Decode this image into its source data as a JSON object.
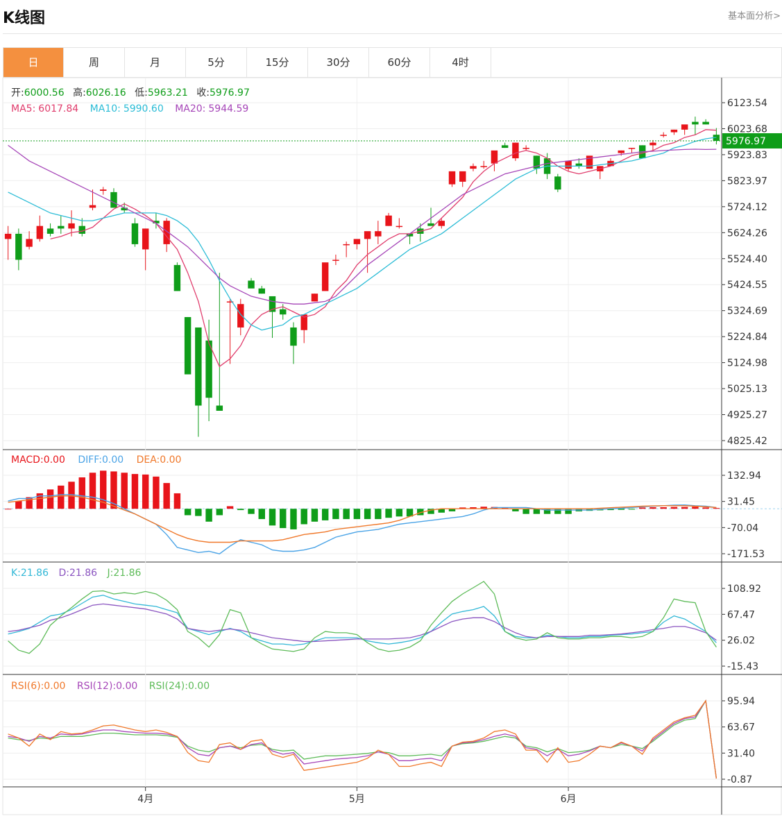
{
  "header": {
    "title": "K线图",
    "more_link": "基本面分析>"
  },
  "tabs": [
    {
      "label": "日",
      "active": true
    },
    {
      "label": "周"
    },
    {
      "label": "月"
    },
    {
      "label": "5分"
    },
    {
      "label": "15分"
    },
    {
      "label": "30分"
    },
    {
      "label": "60分"
    },
    {
      "label": "4时"
    }
  ],
  "colors": {
    "up": "#e8141a",
    "down": "#0f9d19",
    "ma5": "#e03c6c",
    "ma10": "#2bbcd6",
    "ma20": "#a646b8",
    "macd_line": "#f0782a",
    "diff_line": "#4aa3e6",
    "k": "#31b7d6",
    "d": "#8a54c0",
    "j": "#5dbb58",
    "rsi6": "#f0782a",
    "rsi12": "#a646b8",
    "rsi24": "#5dbb58",
    "price_line": "#0f9d19"
  },
  "chart_data": [
    {
      "type": "candlestick",
      "title": "K线图",
      "ohlc_legend": {
        "open_label": "开:",
        "open": "6000.56",
        "high_label": "高:",
        "high": "6026.16",
        "low_label": "低:",
        "low": "5963.21",
        "close_label": "收:",
        "close": "5976.97"
      },
      "ma_legend": {
        "ma5_label": "MA5:",
        "ma5": "6017.84",
        "ma10_label": "MA10:",
        "ma10": "5990.60",
        "ma20_label": "MA20:",
        "ma20": "5944.59"
      },
      "current_price": "5976.97",
      "yticks": [
        "6123.54",
        "6023.68",
        "5923.83",
        "5823.97",
        "5724.12",
        "5624.26",
        "5524.40",
        "5424.55",
        "5324.69",
        "5224.84",
        "5124.98",
        "5025.13",
        "4925.27",
        "4825.42"
      ],
      "ylim": [
        4825.42,
        6123.54
      ],
      "xticks": [
        {
          "label": "4月",
          "index": 13
        },
        {
          "label": "5月",
          "index": 33
        },
        {
          "label": "6月",
          "index": 53
        }
      ],
      "candles": [
        [
          5600,
          5650,
          5520,
          5620
        ],
        [
          5620,
          5640,
          5480,
          5520
        ],
        [
          5570,
          5630,
          5560,
          5600
        ],
        [
          5600,
          5690,
          5590,
          5650
        ],
        [
          5640,
          5660,
          5610,
          5620
        ],
        [
          5650,
          5690,
          5620,
          5640
        ],
        [
          5640,
          5710,
          5610,
          5660
        ],
        [
          5650,
          5680,
          5610,
          5620
        ],
        [
          5720,
          5790,
          5710,
          5730
        ],
        [
          5785,
          5800,
          5770,
          5790
        ],
        [
          5780,
          5795,
          5720,
          5720
        ],
        [
          5720,
          5740,
          5700,
          5710
        ],
        [
          5660,
          5680,
          5570,
          5580
        ],
        [
          5560,
          5640,
          5480,
          5640
        ],
        [
          5670,
          5700,
          5640,
          5660
        ],
        [
          5580,
          5680,
          5550,
          5670
        ],
        [
          5500,
          5510,
          5400,
          5400
        ],
        [
          5300,
          5300,
          5080,
          5080
        ],
        [
          5260,
          5260,
          4840,
          4960
        ],
        [
          5210,
          5290,
          4900,
          4990
        ],
        [
          4960,
          5470,
          4950,
          4940
        ],
        [
          5360,
          5370,
          5120,
          5360
        ],
        [
          5260,
          5370,
          5230,
          5350
        ],
        [
          5440,
          5450,
          5420,
          5410
        ],
        [
          5410,
          5420,
          5390,
          5390
        ],
        [
          5380,
          5380,
          5220,
          5320
        ],
        [
          5330,
          5350,
          5290,
          5310
        ],
        [
          5260,
          5280,
          5120,
          5190
        ],
        [
          5250,
          5290,
          5200,
          5310
        ],
        [
          5360,
          5390,
          5360,
          5390
        ],
        [
          5400,
          5500,
          5400,
          5510
        ],
        [
          5520,
          5540,
          5500,
          5520
        ],
        [
          5580,
          5590,
          5530,
          5580
        ],
        [
          5580,
          5590,
          5560,
          5600
        ],
        [
          5600,
          5610,
          5470,
          5630
        ],
        [
          5610,
          5670,
          5580,
          5630
        ],
        [
          5650,
          5700,
          5650,
          5690
        ],
        [
          5650,
          5680,
          5640,
          5650
        ],
        [
          5620,
          5620,
          5580,
          5610
        ],
        [
          5640,
          5660,
          5590,
          5620
        ],
        [
          5660,
          5720,
          5660,
          5650
        ],
        [
          5650,
          5680,
          5640,
          5670
        ],
        [
          5810,
          5820,
          5800,
          5860
        ],
        [
          5820,
          5850,
          5800,
          5860
        ],
        [
          5870,
          5890,
          5860,
          5880
        ],
        [
          5880,
          5900,
          5870,
          5880
        ],
        [
          5890,
          5920,
          5860,
          5940
        ],
        [
          5960,
          5970,
          5950,
          5950
        ],
        [
          5910,
          5970,
          5900,
          5970
        ],
        [
          5950,
          5960,
          5940,
          5950
        ],
        [
          5920,
          5920,
          5850,
          5870
        ],
        [
          5910,
          5930,
          5830,
          5850
        ],
        [
          5840,
          5850,
          5780,
          5790
        ],
        [
          5870,
          5890,
          5860,
          5900
        ],
        [
          5890,
          5910,
          5870,
          5880
        ],
        [
          5870,
          5910,
          5870,
          5920
        ],
        [
          5860,
          5880,
          5830,
          5880
        ],
        [
          5880,
          5910,
          5880,
          5900
        ],
        [
          5930,
          5940,
          5920,
          5940
        ],
        [
          5950,
          5950,
          5930,
          5950
        ],
        [
          5960,
          5960,
          5930,
          5910
        ],
        [
          5960,
          5980,
          5940,
          5970
        ],
        [
          6000,
          6010,
          5990,
          6000
        ],
        [
          6010,
          6020,
          6000,
          6020
        ],
        [
          6020,
          6030,
          6000,
          6040
        ],
        [
          6050,
          6070,
          6000,
          6040
        ],
        [
          6050,
          6060,
          6040,
          6040
        ],
        [
          6000.56,
          6026.16,
          5963.21,
          5976.97
        ]
      ],
      "ma5": [
        null,
        null,
        null,
        null,
        5600,
        5610,
        5625,
        5630,
        5645,
        5680,
        5715,
        5735,
        5715,
        5690,
        5660,
        5610,
        5560,
        5470,
        5360,
        5200,
        5110,
        5140,
        5190,
        5270,
        5310,
        5330,
        5340,
        5320,
        5300,
        5310,
        5340,
        5400,
        5440,
        5500,
        5540,
        5570,
        5600,
        5620,
        5620,
        5630,
        5640,
        5680,
        5720,
        5760,
        5820,
        5860,
        5890,
        5910,
        5930,
        5940,
        5930,
        5910,
        5880,
        5860,
        5850,
        5860,
        5870,
        5880,
        5900,
        5920,
        5930,
        5940,
        5960,
        5970,
        5990,
        6000,
        6020,
        6017.84
      ],
      "ma10": [
        5780,
        5760,
        5740,
        5720,
        5700,
        5690,
        5680,
        5670,
        5670,
        5680,
        5690,
        5700,
        5700,
        5700,
        5700,
        5690,
        5670,
        5640,
        5590,
        5520,
        5440,
        5370,
        5310,
        5270,
        5250,
        5260,
        5270,
        5300,
        5310,
        5330,
        5350,
        5370,
        5390,
        5410,
        5440,
        5470,
        5500,
        5530,
        5560,
        5580,
        5600,
        5620,
        5650,
        5680,
        5710,
        5740,
        5770,
        5800,
        5830,
        5850,
        5870,
        5880,
        5880,
        5880,
        5880,
        5880,
        5885,
        5890,
        5895,
        5900,
        5910,
        5920,
        5930,
        5950,
        5960,
        5975,
        5985,
        5990.6
      ],
      "ma20": [
        5960,
        5930,
        5900,
        5880,
        5860,
        5840,
        5820,
        5800,
        5780,
        5760,
        5740,
        5720,
        5700,
        5680,
        5660,
        5630,
        5600,
        5570,
        5530,
        5490,
        5450,
        5420,
        5400,
        5380,
        5370,
        5360,
        5355,
        5350,
        5350,
        5355,
        5360,
        5380,
        5420,
        5460,
        5500,
        5530,
        5560,
        5590,
        5620,
        5650,
        5680,
        5710,
        5740,
        5770,
        5790,
        5810,
        5830,
        5850,
        5860,
        5870,
        5880,
        5890,
        5895,
        5900,
        5905,
        5910,
        5915,
        5920,
        5925,
        5930,
        5935,
        5937,
        5940,
        5942,
        5944,
        5945,
        5944,
        5944.59
      ]
    },
    {
      "type": "bar",
      "title": "MACD",
      "legend": {
        "macd_label": "MACD:",
        "macd": "0.00",
        "diff_label": "DIFF:",
        "diff": "0.00",
        "dea_label": "DEA:",
        "dea": "0.00"
      },
      "yticks": [
        "132.94",
        "31.45",
        "-70.04",
        "-171.53"
      ],
      "ylim": [
        -171.53,
        132.94
      ],
      "zero": 3,
      "histogram": [
        0,
        30,
        45,
        60,
        75,
        90,
        105,
        122,
        140,
        148,
        145,
        140,
        135,
        133,
        125,
        100,
        60,
        -25,
        -28,
        -50,
        -25,
        10,
        -5,
        -20,
        -40,
        -65,
        -75,
        -80,
        -60,
        -50,
        -45,
        -40,
        -40,
        -40,
        -40,
        -40,
        -35,
        -30,
        -30,
        -25,
        -20,
        -15,
        -10,
        5,
        6,
        8,
        7,
        4,
        -10,
        -20,
        -20,
        -20,
        -20,
        -20,
        -10,
        -8,
        -6,
        -5,
        -4,
        -3,
        5,
        6,
        6,
        7,
        7,
        8,
        5,
        3
      ],
      "diff": [
        30,
        40,
        40,
        50,
        50,
        55,
        55,
        50,
        45,
        35,
        20,
        0,
        -20,
        -40,
        -60,
        -100,
        -150,
        -160,
        -170,
        -165,
        -175,
        -145,
        -120,
        -130,
        -140,
        -160,
        -165,
        -165,
        -160,
        -150,
        -130,
        -110,
        -100,
        -90,
        -85,
        -80,
        -70,
        -60,
        -55,
        -50,
        -45,
        -40,
        -35,
        -30,
        -20,
        -5,
        5,
        5,
        5,
        5,
        0,
        -5,
        -5,
        -5,
        -5,
        -5,
        -2,
        0,
        2,
        5,
        8,
        10,
        12,
        14,
        15,
        12,
        10,
        5
      ],
      "dea": [
        25,
        30,
        35,
        40,
        45,
        50,
        50,
        45,
        35,
        25,
        10,
        -5,
        -20,
        -40,
        -60,
        -80,
        -100,
        -115,
        -125,
        -130,
        -130,
        -130,
        -125,
        -125,
        -125,
        -125,
        -120,
        -110,
        -100,
        -95,
        -90,
        -80,
        -75,
        -70,
        -65,
        -60,
        -55,
        -45,
        -30,
        -15,
        -5,
        0,
        0,
        0,
        0,
        0,
        0,
        0,
        0,
        0,
        0,
        0,
        0,
        0,
        0,
        0,
        2,
        4,
        6,
        8,
        10,
        11,
        12,
        12,
        12,
        10,
        8,
        5
      ]
    },
    {
      "type": "line",
      "title": "KDJ",
      "legend": {
        "k_label": "K:",
        "k": "21.86",
        "d_label": "D:",
        "d": "21.86",
        "j_label": "J:",
        "j": "21.86"
      },
      "yticks": [
        "108.92",
        "67.47",
        "26.02",
        "-15.43"
      ],
      "ylim": [
        -15.43,
        108.92
      ],
      "k": [
        36,
        40,
        45,
        55,
        65,
        68,
        75,
        85,
        95,
        98,
        92,
        88,
        84,
        82,
        80,
        75,
        70,
        45,
        40,
        35,
        40,
        45,
        40,
        30,
        25,
        20,
        20,
        18,
        20,
        25,
        30,
        30,
        30,
        30,
        25,
        22,
        20,
        22,
        25,
        30,
        40,
        55,
        68,
        72,
        75,
        80,
        65,
        40,
        32,
        30,
        30,
        34,
        32,
        30,
        30,
        32,
        32,
        34,
        35,
        36,
        38,
        40,
        55,
        65,
        60,
        50,
        40,
        22
      ],
      "d": [
        40,
        42,
        46,
        50,
        58,
        62,
        68,
        75,
        82,
        84,
        82,
        80,
        78,
        76,
        72,
        68,
        60,
        45,
        42,
        40,
        42,
        44,
        42,
        38,
        34,
        30,
        28,
        26,
        24,
        24,
        25,
        26,
        27,
        28,
        28,
        28,
        28,
        29,
        30,
        34,
        40,
        48,
        56,
        60,
        62,
        62,
        56,
        46,
        38,
        32,
        30,
        32,
        32,
        32,
        32,
        34,
        34,
        35,
        36,
        38,
        40,
        43,
        45,
        48,
        48,
        44,
        38,
        26
      ],
      "j": [
        25,
        10,
        5,
        20,
        50,
        65,
        78,
        92,
        104,
        105,
        100,
        102,
        100,
        104,
        100,
        90,
        75,
        40,
        30,
        15,
        35,
        75,
        70,
        30,
        20,
        12,
        10,
        8,
        12,
        30,
        40,
        38,
        38,
        35,
        22,
        12,
        8,
        10,
        15,
        25,
        50,
        70,
        88,
        100,
        110,
        120,
        100,
        40,
        30,
        26,
        28,
        38,
        30,
        28,
        28,
        30,
        30,
        32,
        32,
        30,
        32,
        40,
        62,
        92,
        88,
        86,
        40,
        15
      ]
    },
    {
      "type": "line",
      "title": "RSI",
      "legend": {
        "r6_label": "RSI(6):",
        "r6": "0.00",
        "r12_label": "RSI(12):",
        "r12": "0.00",
        "r24_label": "RSI(24):",
        "r24": "0.00"
      },
      "yticks": [
        "95.94",
        "63.67",
        "31.40",
        "-0.87"
      ],
      "ylim": [
        -0.87,
        95.94
      ],
      "rsi6": [
        55,
        50,
        40,
        55,
        48,
        58,
        55,
        56,
        60,
        65,
        66,
        63,
        60,
        58,
        60,
        57,
        52,
        32,
        22,
        20,
        42,
        44,
        36,
        46,
        48,
        30,
        26,
        30,
        10,
        12,
        14,
        16,
        18,
        20,
        25,
        35,
        30,
        15,
        15,
        18,
        20,
        15,
        40,
        45,
        46,
        50,
        58,
        60,
        55,
        35,
        35,
        20,
        38,
        20,
        22,
        30,
        40,
        38,
        45,
        40,
        30,
        50,
        60,
        70,
        75,
        78,
        96,
        0
      ],
      "rsi12": [
        52,
        50,
        46,
        52,
        50,
        55,
        54,
        55,
        58,
        60,
        60,
        58,
        57,
        56,
        56,
        55,
        52,
        38,
        30,
        28,
        38,
        40,
        36,
        42,
        44,
        34,
        30,
        32,
        18,
        20,
        22,
        24,
        25,
        26,
        28,
        33,
        30,
        22,
        22,
        24,
        25,
        22,
        40,
        44,
        45,
        48,
        52,
        55,
        52,
        38,
        36,
        28,
        36,
        28,
        30,
        34,
        40,
        38,
        44,
        40,
        34,
        48,
        58,
        68,
        74,
        76,
        96,
        0
      ],
      "rsi24": [
        50,
        48,
        47,
        50,
        49,
        52,
        52,
        52,
        54,
        56,
        56,
        55,
        54,
        54,
        54,
        53,
        51,
        40,
        35,
        33,
        38,
        40,
        38,
        41,
        42,
        36,
        34,
        35,
        24,
        26,
        28,
        28,
        29,
        30,
        31,
        33,
        32,
        28,
        28,
        29,
        30,
        28,
        40,
        43,
        44,
        46,
        49,
        52,
        50,
        40,
        38,
        33,
        37,
        32,
        33,
        35,
        40,
        38,
        42,
        40,
        37,
        46,
        56,
        66,
        72,
        74,
        96,
        0
      ]
    }
  ]
}
